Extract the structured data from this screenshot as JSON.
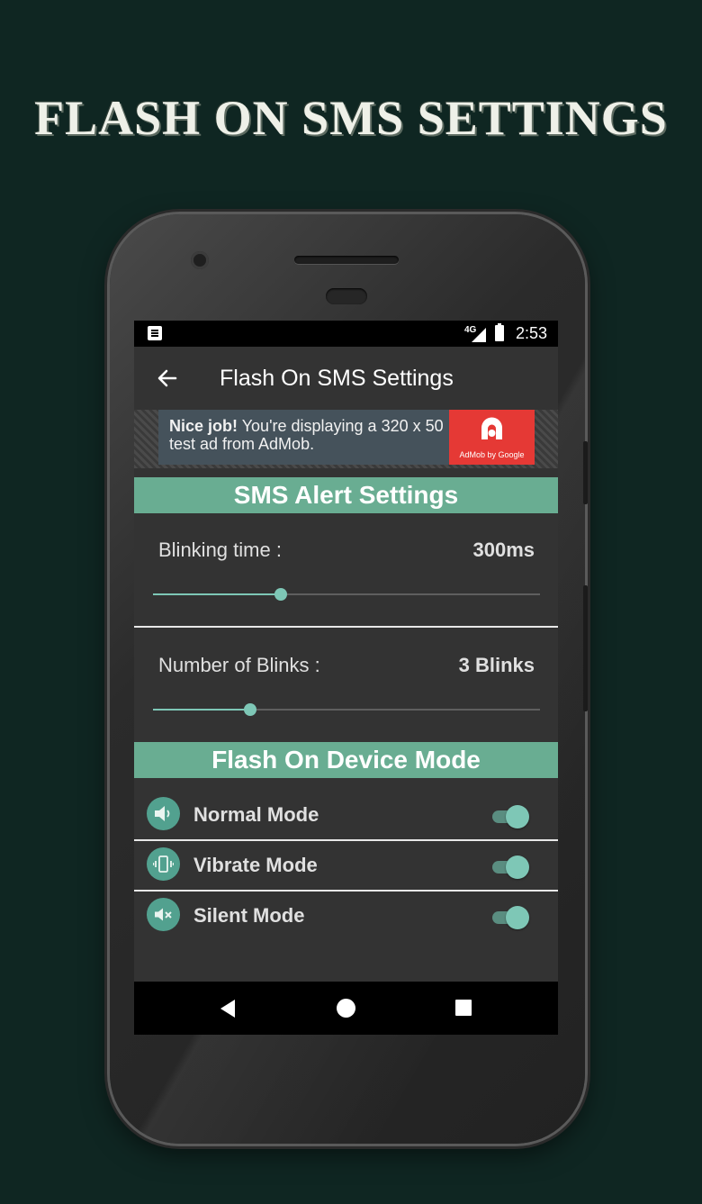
{
  "promo": {
    "title": "FLASH ON SMS SETTINGS"
  },
  "status_bar": {
    "network": "4G",
    "time": "2:53"
  },
  "app_bar": {
    "title": "Flash On SMS Settings",
    "back_icon": "arrow-left-icon"
  },
  "ad": {
    "bold_text": "Nice job!",
    "text": " You're displaying a 320 x 50 test ad from AdMob.",
    "logo_text": "AdMob by Google",
    "logo_color": "#e53935"
  },
  "sms_alert": {
    "header": "SMS Alert Settings",
    "blinking_time": {
      "label": "Blinking time :",
      "value": "300ms",
      "slider_fraction": 0.33
    },
    "number_of_blinks": {
      "label": "Number of Blinks :",
      "value": "3 Blinks",
      "slider_fraction": 0.25
    }
  },
  "device_mode": {
    "header": "Flash On Device Mode",
    "modes": [
      {
        "label": "Normal Mode",
        "icon": "speaker-icon",
        "enabled": true
      },
      {
        "label": "Vibrate Mode",
        "icon": "vibrate-icon",
        "enabled": true
      },
      {
        "label": "Silent Mode",
        "icon": "mute-icon",
        "enabled": true
      }
    ]
  },
  "colors": {
    "accent": "#69ad92",
    "slider": "#7ec7b6",
    "background": "#0f2622",
    "screen": "#333333"
  }
}
